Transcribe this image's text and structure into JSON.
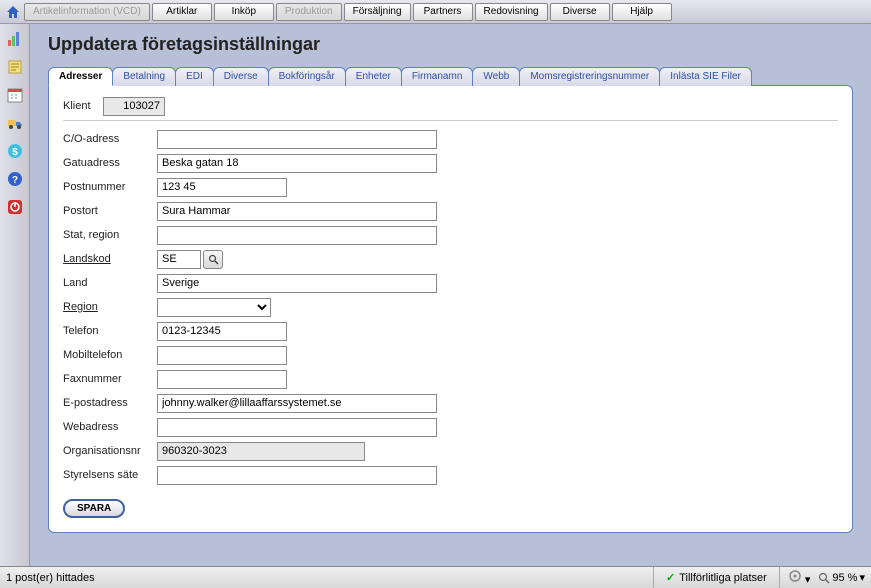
{
  "nav": {
    "artikelinfo": "Artikelinformation (VCD)",
    "artiklar": "Artiklar",
    "inkop": "Inköp",
    "produktion": "Produktion",
    "forsaljning": "Försäljning",
    "partners": "Partners",
    "redovisning": "Redovisning",
    "diverse": "Diverse",
    "hjalp": "Hjälp"
  },
  "page_title": "Uppdatera företagsinställningar",
  "tabs": {
    "adresser": "Adresser",
    "betalning": "Betalning",
    "edi": "EDI",
    "diverse": "Diverse",
    "bokforingsar": "Bokföringsår",
    "enheter": "Enheter",
    "firmanamn": "Firmanamn",
    "webb": "Webb",
    "moms": "Momsregistreringsnummer",
    "sie": "Inlästa SIE Filer"
  },
  "labels": {
    "klient": "Klient",
    "co": "C/O-adress",
    "gatu": "Gatuadress",
    "postnr": "Postnummer",
    "postort": "Postort",
    "stat": "Stat, region",
    "landskod": "Landskod",
    "land": "Land",
    "region": "Region",
    "telefon": "Telefon",
    "mobil": "Mobiltelefon",
    "fax": "Faxnummer",
    "epost": "E-postadress",
    "web": "Webadress",
    "orgnr": "Organisationsnr",
    "styrelse": "Styrelsens säte"
  },
  "values": {
    "klient": "103027",
    "co": "",
    "gatu": "Beska gatan 18",
    "postnr": "123 45",
    "postort": "Sura Hammar",
    "stat": "",
    "landskod": "SE",
    "land": "Sverige",
    "region": "",
    "telefon": "0123-12345",
    "mobil": "",
    "fax": "",
    "epost": "johnny.walker@lillaaffarssystemet.se",
    "web": "",
    "orgnr": "960320-3023",
    "styrelse": ""
  },
  "buttons": {
    "save": "SPARA"
  },
  "status": {
    "left": "1 post(er) hittades",
    "trusted": "Tillförlitliga platser",
    "zoom": "95 %"
  }
}
